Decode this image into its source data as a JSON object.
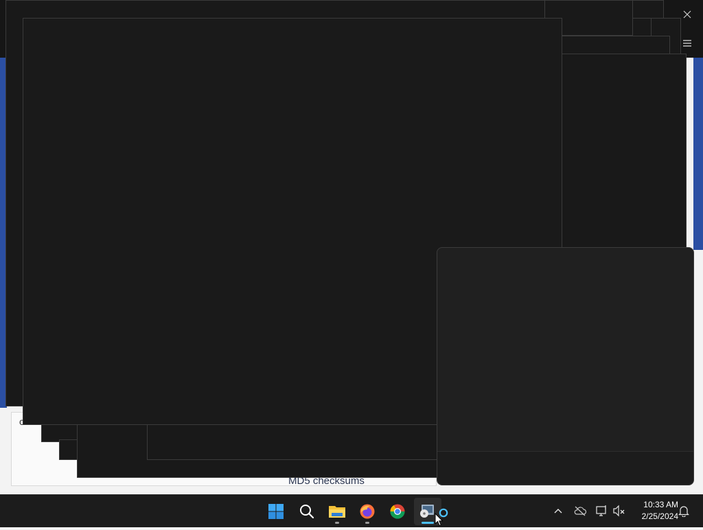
{
  "desktop": {
    "background_text": "MD5 checksums",
    "stray_text": "c"
  },
  "window_controls": {
    "close_icon": "close-icon",
    "menu_icon": "hamburger-menu-icon"
  },
  "taskbar": {
    "items": [
      {
        "name": "start",
        "icon": "windows-logo-icon",
        "running": false,
        "active": false
      },
      {
        "name": "search",
        "icon": "search-icon",
        "running": false,
        "active": false
      },
      {
        "name": "file-explorer",
        "icon": "folder-icon",
        "running": true,
        "active": false
      },
      {
        "name": "firefox",
        "icon": "firefox-icon",
        "running": true,
        "active": false
      },
      {
        "name": "chrome",
        "icon": "chrome-icon",
        "running": false,
        "active": false
      },
      {
        "name": "disk-app",
        "icon": "disk-utility-icon",
        "running": true,
        "active": true
      }
    ],
    "tray": {
      "overflow_icon": "chevron-up-icon",
      "onedrive_icon": "cloud-off-icon",
      "network_icon": "network-icon",
      "volume_icon": "speaker-muted-icon",
      "notification_icon": "bell-icon"
    },
    "clock": {
      "time": "10:33 AM",
      "date": "2/25/2024"
    }
  },
  "colors": {
    "taskbar": "#1c1c1c",
    "window": "#191919",
    "accent": "#4cc2ff",
    "desktop_accent": "#2b4fa3"
  }
}
